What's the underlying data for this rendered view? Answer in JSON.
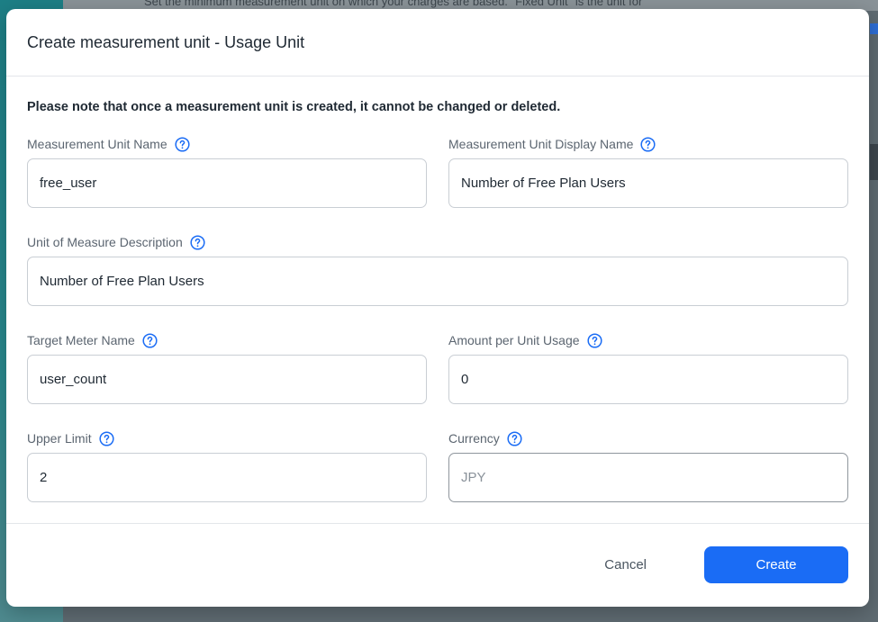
{
  "background": {
    "partial_text": "Set the minimum measurement unit on which your charges are based. \"Fixed Unit\" is the unit for"
  },
  "modal": {
    "title": "Create measurement unit - Usage Unit",
    "notice": "Please note that once a measurement unit is created, it cannot be changed or deleted.",
    "fields": {
      "unit_name": {
        "label": "Measurement Unit Name",
        "value": "free_user"
      },
      "display_name": {
        "label": "Measurement Unit Display Name",
        "value": "Number of Free Plan Users"
      },
      "description": {
        "label": "Unit of Measure Description",
        "value": "Number of Free Plan Users"
      },
      "meter_name": {
        "label": "Target Meter Name",
        "value": "user_count"
      },
      "amount": {
        "label": "Amount per Unit Usage",
        "value": "0"
      },
      "upper_limit": {
        "label": "Upper Limit",
        "value": "2"
      },
      "currency": {
        "label": "Currency",
        "value": "JPY"
      }
    },
    "footer": {
      "cancel_label": "Cancel",
      "create_label": "Create"
    }
  },
  "icons": {
    "help": "question-circle-icon"
  },
  "colors": {
    "accent": "#1a6cf5",
    "help_icon": "#1a6cf5"
  }
}
